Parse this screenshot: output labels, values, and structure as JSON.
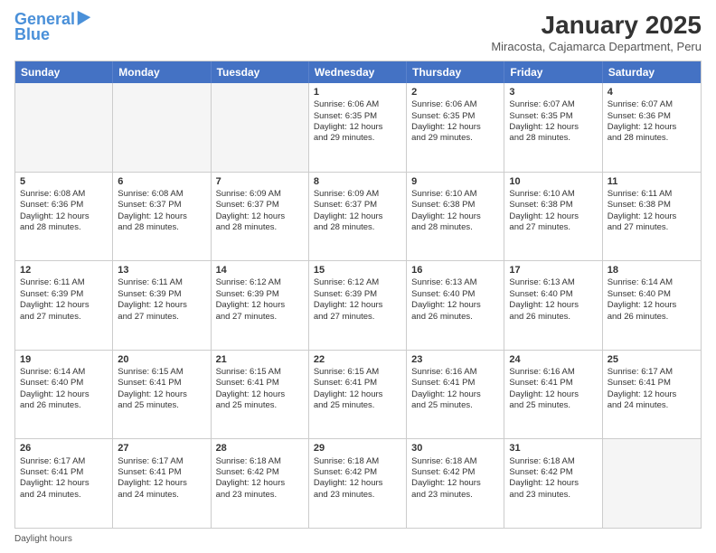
{
  "logo": {
    "line1": "General",
    "line2": "Blue"
  },
  "title": "January 2025",
  "subtitle": "Miracosta, Cajamarca Department, Peru",
  "days": [
    "Sunday",
    "Monday",
    "Tuesday",
    "Wednesday",
    "Thursday",
    "Friday",
    "Saturday"
  ],
  "footer": "Daylight hours",
  "weeks": [
    [
      {
        "day": "",
        "info": ""
      },
      {
        "day": "",
        "info": ""
      },
      {
        "day": "",
        "info": ""
      },
      {
        "day": "1",
        "info": "Sunrise: 6:06 AM\nSunset: 6:35 PM\nDaylight: 12 hours\nand 29 minutes."
      },
      {
        "day": "2",
        "info": "Sunrise: 6:06 AM\nSunset: 6:35 PM\nDaylight: 12 hours\nand 29 minutes."
      },
      {
        "day": "3",
        "info": "Sunrise: 6:07 AM\nSunset: 6:35 PM\nDaylight: 12 hours\nand 28 minutes."
      },
      {
        "day": "4",
        "info": "Sunrise: 6:07 AM\nSunset: 6:36 PM\nDaylight: 12 hours\nand 28 minutes."
      }
    ],
    [
      {
        "day": "5",
        "info": "Sunrise: 6:08 AM\nSunset: 6:36 PM\nDaylight: 12 hours\nand 28 minutes."
      },
      {
        "day": "6",
        "info": "Sunrise: 6:08 AM\nSunset: 6:37 PM\nDaylight: 12 hours\nand 28 minutes."
      },
      {
        "day": "7",
        "info": "Sunrise: 6:09 AM\nSunset: 6:37 PM\nDaylight: 12 hours\nand 28 minutes."
      },
      {
        "day": "8",
        "info": "Sunrise: 6:09 AM\nSunset: 6:37 PM\nDaylight: 12 hours\nand 28 minutes."
      },
      {
        "day": "9",
        "info": "Sunrise: 6:10 AM\nSunset: 6:38 PM\nDaylight: 12 hours\nand 28 minutes."
      },
      {
        "day": "10",
        "info": "Sunrise: 6:10 AM\nSunset: 6:38 PM\nDaylight: 12 hours\nand 27 minutes."
      },
      {
        "day": "11",
        "info": "Sunrise: 6:11 AM\nSunset: 6:38 PM\nDaylight: 12 hours\nand 27 minutes."
      }
    ],
    [
      {
        "day": "12",
        "info": "Sunrise: 6:11 AM\nSunset: 6:39 PM\nDaylight: 12 hours\nand 27 minutes."
      },
      {
        "day": "13",
        "info": "Sunrise: 6:11 AM\nSunset: 6:39 PM\nDaylight: 12 hours\nand 27 minutes."
      },
      {
        "day": "14",
        "info": "Sunrise: 6:12 AM\nSunset: 6:39 PM\nDaylight: 12 hours\nand 27 minutes."
      },
      {
        "day": "15",
        "info": "Sunrise: 6:12 AM\nSunset: 6:39 PM\nDaylight: 12 hours\nand 27 minutes."
      },
      {
        "day": "16",
        "info": "Sunrise: 6:13 AM\nSunset: 6:40 PM\nDaylight: 12 hours\nand 26 minutes."
      },
      {
        "day": "17",
        "info": "Sunrise: 6:13 AM\nSunset: 6:40 PM\nDaylight: 12 hours\nand 26 minutes."
      },
      {
        "day": "18",
        "info": "Sunrise: 6:14 AM\nSunset: 6:40 PM\nDaylight: 12 hours\nand 26 minutes."
      }
    ],
    [
      {
        "day": "19",
        "info": "Sunrise: 6:14 AM\nSunset: 6:40 PM\nDaylight: 12 hours\nand 26 minutes."
      },
      {
        "day": "20",
        "info": "Sunrise: 6:15 AM\nSunset: 6:41 PM\nDaylight: 12 hours\nand 25 minutes."
      },
      {
        "day": "21",
        "info": "Sunrise: 6:15 AM\nSunset: 6:41 PM\nDaylight: 12 hours\nand 25 minutes."
      },
      {
        "day": "22",
        "info": "Sunrise: 6:15 AM\nSunset: 6:41 PM\nDaylight: 12 hours\nand 25 minutes."
      },
      {
        "day": "23",
        "info": "Sunrise: 6:16 AM\nSunset: 6:41 PM\nDaylight: 12 hours\nand 25 minutes."
      },
      {
        "day": "24",
        "info": "Sunrise: 6:16 AM\nSunset: 6:41 PM\nDaylight: 12 hours\nand 25 minutes."
      },
      {
        "day": "25",
        "info": "Sunrise: 6:17 AM\nSunset: 6:41 PM\nDaylight: 12 hours\nand 24 minutes."
      }
    ],
    [
      {
        "day": "26",
        "info": "Sunrise: 6:17 AM\nSunset: 6:41 PM\nDaylight: 12 hours\nand 24 minutes."
      },
      {
        "day": "27",
        "info": "Sunrise: 6:17 AM\nSunset: 6:41 PM\nDaylight: 12 hours\nand 24 minutes."
      },
      {
        "day": "28",
        "info": "Sunrise: 6:18 AM\nSunset: 6:42 PM\nDaylight: 12 hours\nand 23 minutes."
      },
      {
        "day": "29",
        "info": "Sunrise: 6:18 AM\nSunset: 6:42 PM\nDaylight: 12 hours\nand 23 minutes."
      },
      {
        "day": "30",
        "info": "Sunrise: 6:18 AM\nSunset: 6:42 PM\nDaylight: 12 hours\nand 23 minutes."
      },
      {
        "day": "31",
        "info": "Sunrise: 6:18 AM\nSunset: 6:42 PM\nDaylight: 12 hours\nand 23 minutes."
      },
      {
        "day": "",
        "info": ""
      }
    ]
  ]
}
